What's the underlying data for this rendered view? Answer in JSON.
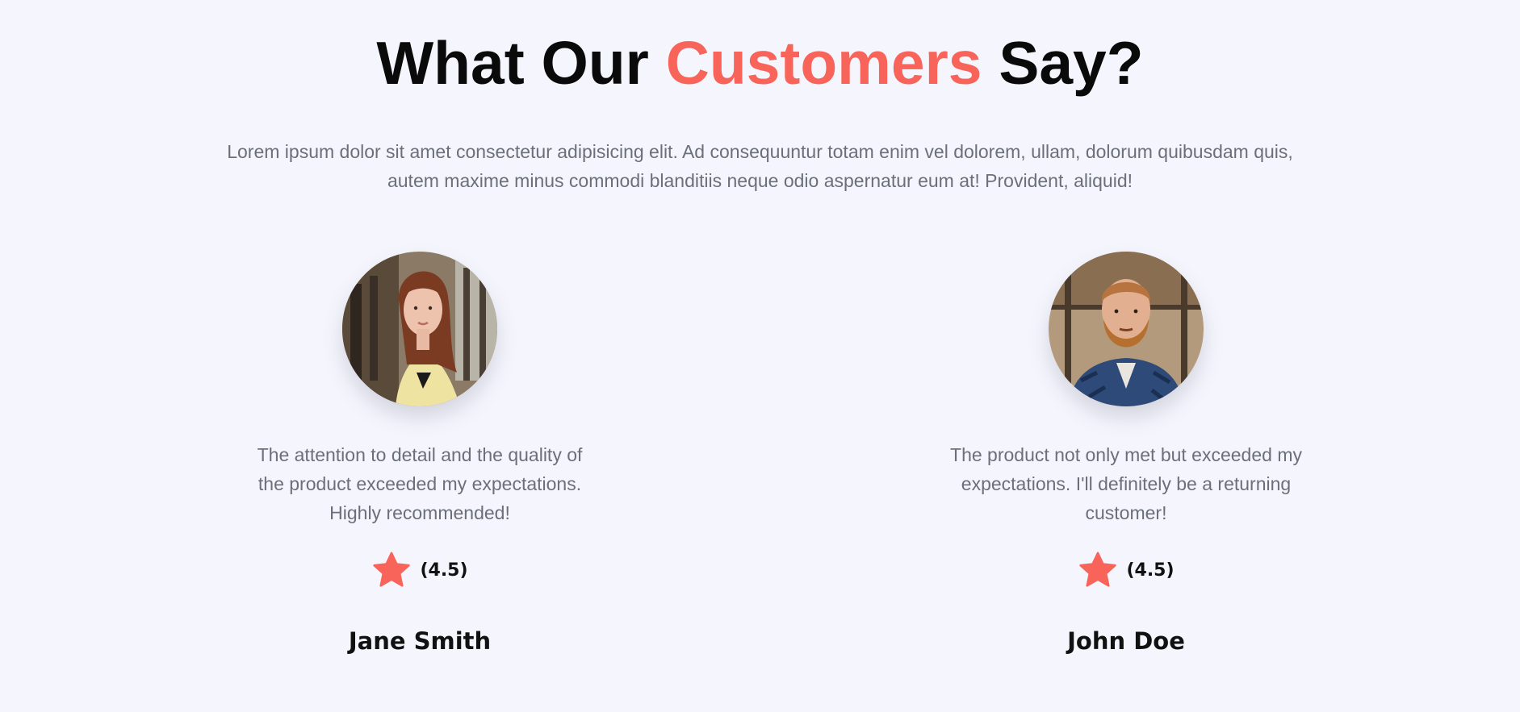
{
  "heading": {
    "part1": "What Our ",
    "accent": "Customers",
    "part2": " Say?",
    "accent_color": "#f8645a"
  },
  "intro": "Lorem ipsum dolor sit amet consectetur adipisicing elit. Ad consequuntur totam enim vel dolorem, ullam, dolorum quibusdam quis, autem maxime minus commodi blanditiis neque odio aspernatur eum at! Provident, aliquid!",
  "testimonials": [
    {
      "quote": "The attention to detail and the quality of the product exceeded my expectations. Highly recommended!",
      "rating_label": "(4.5)",
      "rating": 4.5,
      "name": "Jane Smith",
      "avatar": "woman-portrait"
    },
    {
      "quote": "The product not only met but exceeded my expectations. I'll definitely be a returning customer!",
      "rating_label": "(4.5)",
      "rating": 4.5,
      "name": "John Doe",
      "avatar": "man-portrait"
    }
  ],
  "colors": {
    "background": "#f5f6fd",
    "star": "#f8645a",
    "text_muted": "#6b6f78"
  }
}
